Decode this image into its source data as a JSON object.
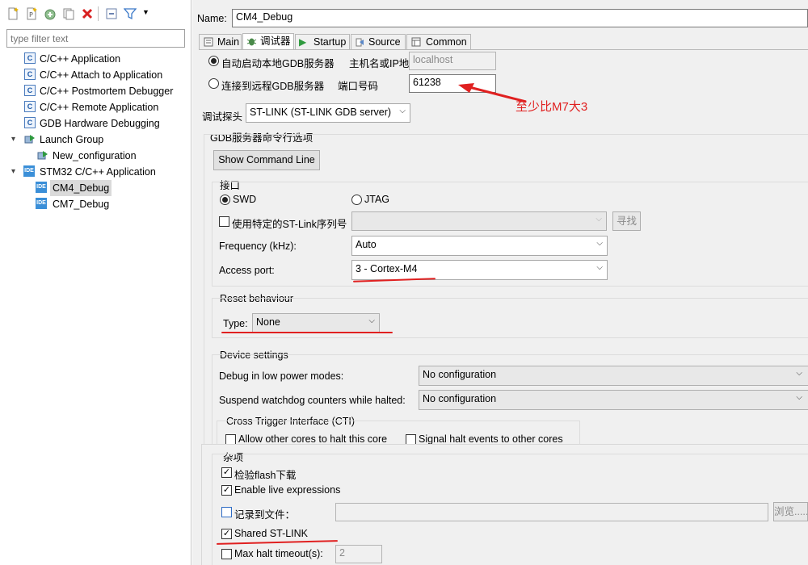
{
  "left": {
    "filter_placeholder": "type filter text",
    "tree": [
      {
        "label": "C/C++ Application",
        "icon": "c-icon"
      },
      {
        "label": "C/C++ Attach to Application",
        "icon": "c-icon"
      },
      {
        "label": "C/C++ Postmortem Debugger",
        "icon": "c-icon"
      },
      {
        "label": "C/C++ Remote Application",
        "icon": "c-icon"
      },
      {
        "label": "GDB Hardware Debugging",
        "icon": "c-icon"
      },
      {
        "label": "Launch Group",
        "icon": "launch-group-icon"
      },
      {
        "label": "New_configuration",
        "icon": "launch-config-icon"
      },
      {
        "label": "STM32 C/C++ Application",
        "icon": "ide-icon"
      },
      {
        "label": "CM4_Debug",
        "icon": "ide-icon"
      },
      {
        "label": "CM7_Debug",
        "icon": "ide-icon"
      }
    ]
  },
  "right": {
    "name_label": "Name:",
    "name_value": "CM4_Debug",
    "tabs": [
      "Main",
      "调试器",
      "Startup",
      "Source",
      "Common"
    ],
    "gdb": {
      "local_radio": "自动启动本地GDB服务器",
      "host_label": "主机名或IP地址",
      "host_value": "localhost",
      "remote_radio": "连接到远程GDB服务器",
      "port_label": "端口号码",
      "port_value": "61238",
      "annotation": "至少比M7大3"
    },
    "probe_label": "调试探头",
    "probe_value": "ST-LINK (ST-LINK GDB server)",
    "server_options_title": "GDB服务器命令行选项",
    "show_cmd_button": "Show Command Line",
    "interface": {
      "title": "接口",
      "swd": "SWD",
      "jtag": "JTAG",
      "serial_checkbox": "使用特定的ST-Link序列号",
      "find_button": "寻找",
      "frequency_label": "Frequency (kHz):",
      "frequency_value": "Auto",
      "access_label": "Access port:",
      "access_value": "3 - Cortex-M4"
    },
    "reset": {
      "title": "Reset behaviour",
      "type_label": "Type:",
      "type_value": "None"
    },
    "device": {
      "title": "Device settings",
      "lowpower_label": "Debug in low power modes:",
      "lowpower_value": "No configuration",
      "watchdog_label": "Suspend watchdog counters while halted:",
      "watchdog_value": "No configuration",
      "cti_title": "Cross Trigger Interface (CTI)",
      "cti_allow": "Allow other cores to halt this core",
      "cti_signal": "Signal halt events to other cores"
    },
    "misc": {
      "title": "杂项",
      "verify_flash": "检验flash下载",
      "live_expr": "Enable live expressions",
      "log_file": "记录到文件：",
      "browse_button": "浏览......",
      "shared_stlink": "Shared ST-LINK",
      "max_halt": "Max halt timeout(s):",
      "max_halt_value": "2"
    }
  },
  "colors": {
    "annotation_red": "#e02020"
  }
}
